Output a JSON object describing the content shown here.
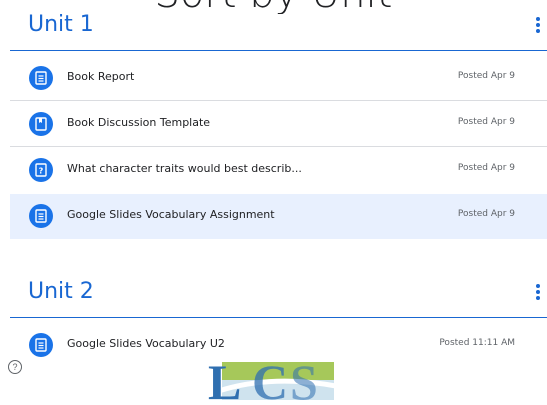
{
  "page": {
    "heading": "Sort by Unit"
  },
  "topics": [
    {
      "title": "Unit 1",
      "items": [
        {
          "title": "Book Report",
          "posted": "Posted Apr 9",
          "icon": "assignment-icon"
        },
        {
          "title": "Book Discussion Template",
          "posted": "Posted Apr 9",
          "icon": "material-icon"
        },
        {
          "title": "What character traits would best describ...",
          "posted": "Posted Apr 9",
          "icon": "question-icon"
        },
        {
          "title": "Google Slides Vocabulary Assignment",
          "posted": "Posted Apr 9",
          "icon": "assignment-icon"
        }
      ]
    },
    {
      "title": "Unit 2",
      "items": [
        {
          "title": "Google Slides Vocabulary U2",
          "posted": "Posted 11:11 AM",
          "icon": "assignment-icon"
        }
      ]
    }
  ],
  "help": {
    "label": "?"
  },
  "logo": {
    "text": "LCS"
  },
  "colors": {
    "accent": "#1967d2",
    "icon_bg": "#1a73e8",
    "selected_row": "#e8f0fe",
    "divider": "#dadce0",
    "muted_text": "#5f6368",
    "logo_green": "#a6c85a",
    "logo_blue": "#2f6fb0"
  }
}
